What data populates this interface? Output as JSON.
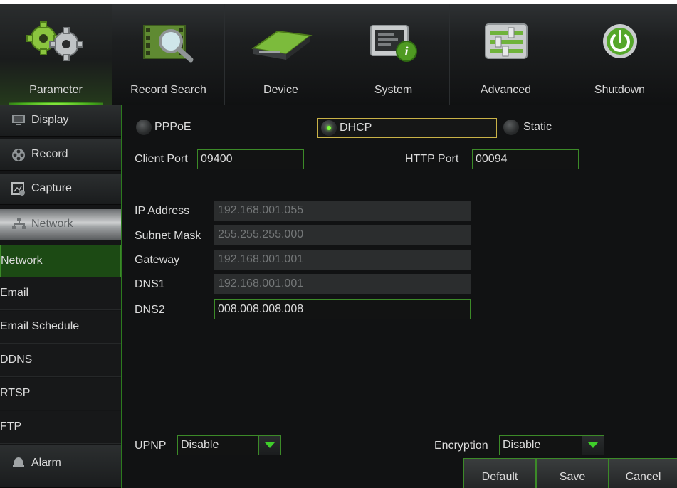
{
  "toolbar": {
    "items": [
      {
        "label": "Parameter",
        "icon": "gears-icon"
      },
      {
        "label": "Record Search",
        "icon": "film-search-icon"
      },
      {
        "label": "Device",
        "icon": "hard-drive-icon"
      },
      {
        "label": "System",
        "icon": "system-info-icon"
      },
      {
        "label": "Advanced",
        "icon": "sliders-icon"
      },
      {
        "label": "Shutdown",
        "icon": "power-icon"
      }
    ]
  },
  "sidebar": {
    "categories": [
      {
        "label": "Display",
        "icon": "monitor-icon"
      },
      {
        "label": "Record",
        "icon": "film-reel-icon"
      },
      {
        "label": "Capture",
        "icon": "capture-icon"
      },
      {
        "label": "Network",
        "icon": "network-icon"
      }
    ],
    "network_items": [
      "Network",
      "Email",
      "Email Schedule",
      "DDNS",
      "RTSP",
      "FTP"
    ],
    "alarm": {
      "label": "Alarm",
      "icon": "alarm-icon"
    }
  },
  "network": {
    "modes": [
      "PPPoE",
      "DHCP",
      "Static"
    ],
    "selected_mode": "DHCP",
    "client_port_label": "Client Port",
    "client_port": "09400",
    "http_port_label": "HTTP Port",
    "http_port": "00094",
    "ip_label": "IP Address",
    "ip": "192.168.001.055",
    "subnet_label": "Subnet Mask",
    "subnet": "255.255.255.000",
    "gateway_label": "Gateway",
    "gateway": "192.168.001.001",
    "dns1_label": "DNS1",
    "dns1": "192.168.001.001",
    "dns2_label": "DNS2",
    "dns2": "008.008.008.008",
    "upnp_label": "UPNP",
    "upnp": "Disable",
    "encryption_label": "Encryption",
    "encryption": "Disable"
  },
  "buttons": {
    "default": "Default",
    "save": "Save",
    "cancel": "Cancel"
  },
  "colors": {
    "accent": "#3c8a28",
    "highlight": "#7cff3a",
    "background": "#111213"
  }
}
